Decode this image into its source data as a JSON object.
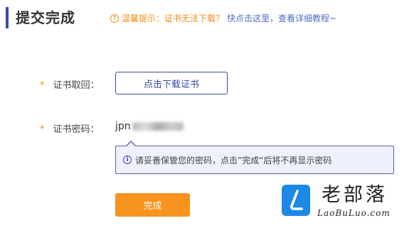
{
  "page": {
    "title": "提交完成",
    "tip_prefix": "温馨提示：证书无法下载？",
    "tip_link": "快点击这里，查看详细教程~",
    "tip_icon": "info-icon"
  },
  "cert_download": {
    "required_mark": "*",
    "label": "证书取回：",
    "button_label": "点击下载证书"
  },
  "cert_password": {
    "required_mark": "*",
    "label": "证书密码：",
    "value_visible": "jpn"
  },
  "notice": {
    "text": "请妥善保管您的密码，点击”完成“后将不再显示密码",
    "icon": "info-icon"
  },
  "actions": {
    "done_label": "完成"
  },
  "watermark": {
    "logo_letter": "L",
    "name": "老部落",
    "url": "LaoBuLuo.com"
  },
  "colors": {
    "accent": "#3a4aa8",
    "warning": "#f08c1a",
    "primary_button": "#f7931e",
    "notice_bg": "#eef0fb"
  }
}
